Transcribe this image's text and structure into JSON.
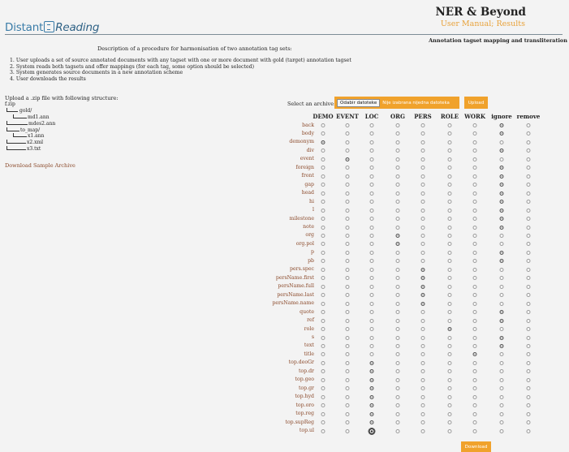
{
  "header": {
    "logo_main": "Distant",
    "logo_italic": "Reading",
    "app_title": "NER & Beyond",
    "link_manual": "User Manual",
    "link_sep": ";",
    "link_results": "Results",
    "subtitle": "Annotation tagset mapping and transliteration"
  },
  "description": {
    "title": "Description of a procedure for harmonisation of two annotation tag sets:",
    "steps": [
      "1. User uploads a set of source annotated documents with any tagset with one or more document with gold (target) annotation tagset",
      "2. System reads both tagsets and offer mappings (for each tag, some option should be selected)",
      "3. System generates source documents in a new annotation scheme",
      "4. User downloads the results"
    ]
  },
  "upload": {
    "intro": "Upload a .zip file with following structure:",
    "tree": [
      "f.zip",
      "gold/",
      "md1.ann",
      "mdes2.ann",
      "to_map/",
      "x1.ann",
      "x2.xml",
      "x3.txt"
    ],
    "sample_link": "Download Sample Archive"
  },
  "archive": {
    "label": "Select an archive:",
    "choose_button": "Odabir datoteke",
    "status": "Nije izabrana nijedna datoteka",
    "upload_button": "Upload"
  },
  "mapping": {
    "columns": [
      "DEMO",
      "EVENT",
      "LOC",
      "ORG",
      "PERS",
      "ROLE",
      "WORK",
      "ignore",
      "remove"
    ],
    "rows": [
      {
        "tag": "back",
        "selected": 7
      },
      {
        "tag": "body",
        "selected": 7
      },
      {
        "tag": "demonym",
        "selected": 0
      },
      {
        "tag": "div",
        "selected": 7
      },
      {
        "tag": "event",
        "selected": 1
      },
      {
        "tag": "foreign",
        "selected": 7
      },
      {
        "tag": "front",
        "selected": 7
      },
      {
        "tag": "gap",
        "selected": 7
      },
      {
        "tag": "head",
        "selected": 7
      },
      {
        "tag": "hi",
        "selected": 7
      },
      {
        "tag": "l",
        "selected": 7
      },
      {
        "tag": "milestone",
        "selected": 7
      },
      {
        "tag": "note",
        "selected": 7
      },
      {
        "tag": "org",
        "selected": 3
      },
      {
        "tag": "org.pol",
        "selected": 3
      },
      {
        "tag": "p",
        "selected": 7
      },
      {
        "tag": "pb",
        "selected": 7
      },
      {
        "tag": "pers.spec",
        "selected": 4
      },
      {
        "tag": "persName.first",
        "selected": 4
      },
      {
        "tag": "persName.full",
        "selected": 4
      },
      {
        "tag": "persName.last",
        "selected": 4
      },
      {
        "tag": "persName.name",
        "selected": 4
      },
      {
        "tag": "quote",
        "selected": 7
      },
      {
        "tag": "ref",
        "selected": 7
      },
      {
        "tag": "role",
        "selected": 5
      },
      {
        "tag": "s",
        "selected": 7
      },
      {
        "tag": "text",
        "selected": 7
      },
      {
        "tag": "title",
        "selected": 6
      },
      {
        "tag": "top.deoGr",
        "selected": 2
      },
      {
        "tag": "top.dr",
        "selected": 2
      },
      {
        "tag": "top.geo",
        "selected": 2
      },
      {
        "tag": "top.gr",
        "selected": 2
      },
      {
        "tag": "top.hyd",
        "selected": 2
      },
      {
        "tag": "top.oro",
        "selected": 2
      },
      {
        "tag": "top.reg",
        "selected": 2
      },
      {
        "tag": "top.supReg",
        "selected": 2
      },
      {
        "tag": "top.ul",
        "selected": 2,
        "focused": true
      }
    ],
    "download_button": "Download"
  }
}
